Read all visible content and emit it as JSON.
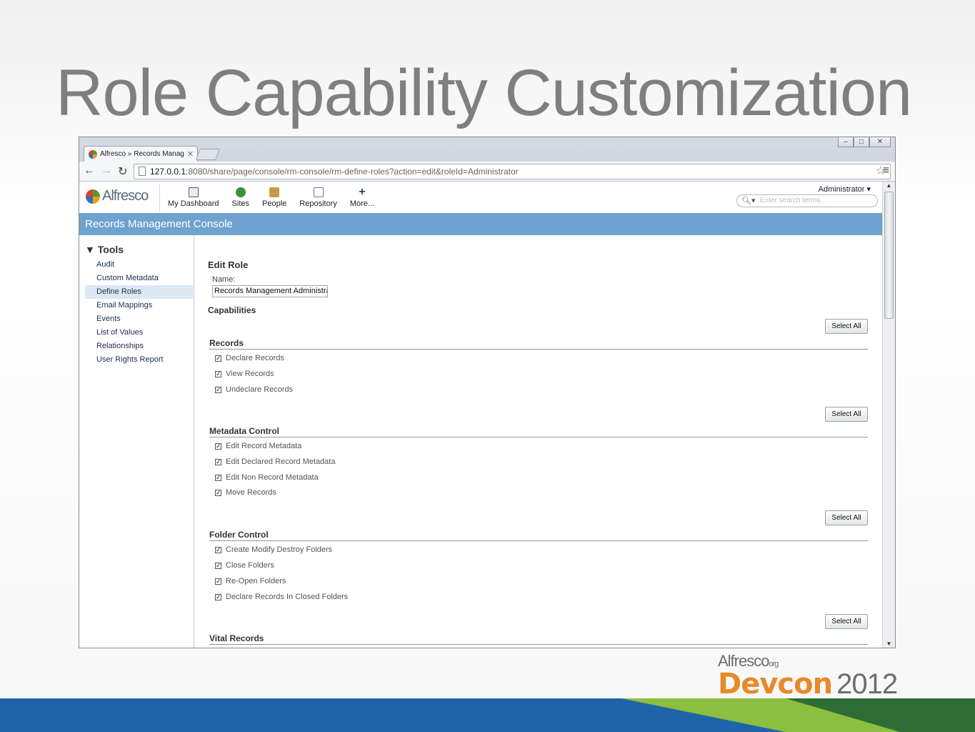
{
  "slide": {
    "title": "Role Capability Customization"
  },
  "browser": {
    "tab_title": "Alfresco » Records Managem",
    "url_host": "127.0.0.1",
    "url_rest": ":8080/share/page/console/rm-console/rm-define-roles?action=edit&roleId=Administrator"
  },
  "app": {
    "logo": "Alfresco",
    "nav": [
      "My Dashboard",
      "Sites",
      "People",
      "Repository",
      "More..."
    ],
    "user": "Administrator",
    "search_placeholder": "Enter search terms..."
  },
  "console_title": "Records Management Console",
  "sidebar": {
    "heading": "Tools",
    "items": [
      "Audit",
      "Custom Metadata",
      "Define Roles",
      "Email Mappings",
      "Events",
      "List of Values",
      "Relationships",
      "User Rights Report"
    ],
    "active": "Define Roles"
  },
  "edit": {
    "heading": "Edit Role",
    "name_label": "Name:",
    "name_value": "Records Management Administra",
    "capabilities_label": "Capabilities",
    "select_all": "Select All"
  },
  "groups": [
    {
      "title": "Records",
      "items": [
        "Declare Records",
        "View Records",
        "Undeclare Records"
      ]
    },
    {
      "title": "Metadata Control",
      "items": [
        "Edit Record Metadata",
        "Edit Declared Record Metadata",
        "Edit Non Record Metadata",
        "Move Records"
      ]
    },
    {
      "title": "Folder Control",
      "items": [
        "Create Modify Destroy Folders",
        "Close Folders",
        "Re-Open Folders",
        "Declare Records In Closed Folders"
      ]
    },
    {
      "title": "Vital Records",
      "items": []
    }
  ],
  "branding": {
    "org": "Alfresco",
    "org_suffix": "org",
    "event": "Devcon",
    "year": "2012"
  },
  "colors": {
    "title_bar": "#6fa2ce",
    "band_blue": "#1f64a8",
    "band_green": "#8cbf3f",
    "devcon_orange": "#e8892a"
  }
}
